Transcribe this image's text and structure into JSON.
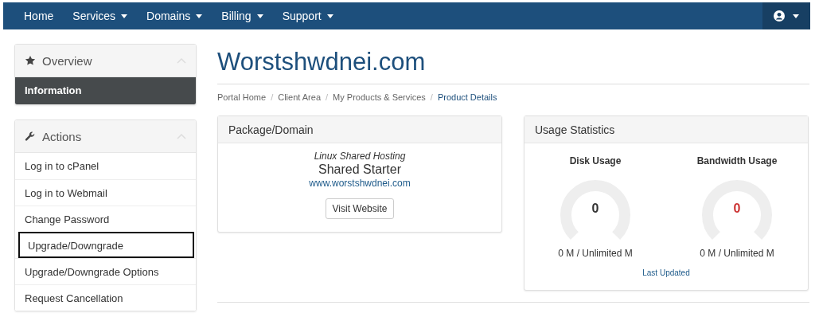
{
  "navbar": {
    "items": [
      {
        "label": "Home",
        "dropdown": false
      },
      {
        "label": "Services",
        "dropdown": true
      },
      {
        "label": "Domains",
        "dropdown": true
      },
      {
        "label": "Billing",
        "dropdown": true
      },
      {
        "label": "Support",
        "dropdown": true
      }
    ]
  },
  "sidebar": {
    "panels": [
      {
        "title": "Overview",
        "kind": "star",
        "items": [
          {
            "label": "Information",
            "selected": true,
            "focused": false
          }
        ]
      },
      {
        "title": "Actions",
        "kind": "wrench",
        "items": [
          {
            "label": "Log in to cPanel",
            "selected": false,
            "focused": false
          },
          {
            "label": "Log in to Webmail",
            "selected": false,
            "focused": false
          },
          {
            "label": "Change Password",
            "selected": false,
            "focused": false
          },
          {
            "label": "Upgrade/Downgrade",
            "selected": false,
            "focused": true
          },
          {
            "label": "Upgrade/Downgrade Options",
            "selected": false,
            "focused": false
          },
          {
            "label": "Request Cancellation",
            "selected": false,
            "focused": false
          }
        ]
      }
    ]
  },
  "page": {
    "title": "Worstshwdnei.com",
    "breadcrumb_separator": "/",
    "breadcrumb": [
      {
        "label": "Portal Home",
        "current": false
      },
      {
        "label": "Client Area",
        "current": false
      },
      {
        "label": "My Products & Services",
        "current": false
      },
      {
        "label": "Product Details",
        "current": true
      }
    ]
  },
  "package": {
    "title": "Package/Domain",
    "group": "Linux Shared Hosting",
    "product": "Shared Starter",
    "domain": "www.worstshwdnei.com",
    "button": "Visit Website"
  },
  "usage": {
    "title": "Usage Statistics",
    "gauges": [
      {
        "label": "Disk Usage",
        "value": "0",
        "color": "#333333",
        "detail": "0 M / Unlimited M"
      },
      {
        "label": "Bandwidth Usage",
        "value": "0",
        "color": "#cc3333",
        "detail": "0 M / Unlimited M"
      }
    ],
    "last_updated": "Last Updated"
  }
}
